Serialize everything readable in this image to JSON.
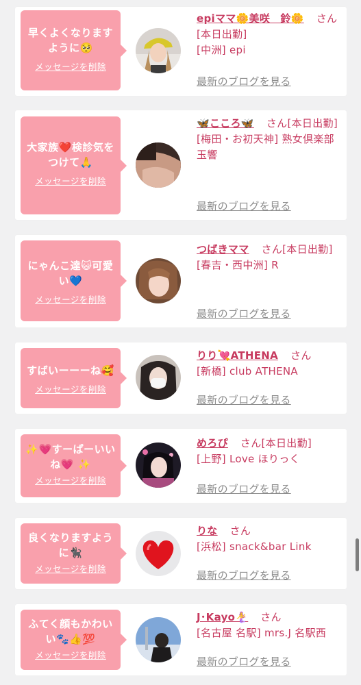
{
  "delete_label": "メッセージを削除",
  "blog_label": "最新のブログを見る",
  "san_label": "さん",
  "colors": {
    "bubble": "#f9a0ac",
    "name": "#c73a5f",
    "link_gray": "#8c8c8c",
    "card": "#ffffff",
    "page": "#f1f1f2"
  },
  "cards": [
    {
      "message": "早くよくなりますように🥺",
      "name": "epiママ🌼美咲　鈴🌼",
      "tail": "[本日出勤]",
      "shop": "[中洲] epi",
      "avatar": "photo-woman-yellow-cap"
    },
    {
      "message": "大家族❤️検診気をつけて🙏",
      "name": "🦋こころ🦋",
      "tail": "[本日出勤]",
      "shop": "[梅田・お初天神] 熟女倶楽部 玉響",
      "avatar": "photo-woman-shoulder"
    },
    {
      "message": "にゃんこ達😺可愛い💙",
      "name": "つばきママ",
      "tail": "[本日出勤]",
      "shop": "[春吉・西中洲] R",
      "avatar": "photo-woman-closeup"
    },
    {
      "message": "すばいーーーね🥰",
      "name": "りり💘ATHENA",
      "tail": "",
      "shop": "[新橋] club ATHENA",
      "avatar": "photo-woman-mask"
    },
    {
      "message": "✨💗すーぱーいいね💗 ✨",
      "name": "めろぴ",
      "tail": "[本日出勤]",
      "shop": "[上野] Love ほりっく",
      "avatar": "photo-woman-dark"
    },
    {
      "message": "良くなりますように🐈‍⬛",
      "name": "りな",
      "tail": "",
      "shop": "[浜松] snack&bar Link",
      "avatar": "red-heart-image"
    },
    {
      "message": "ふてく顔もかわいい🐾👍💯",
      "name": "J･Kayo🧜‍♀️",
      "tail": "",
      "shop": "[名古屋 名駅] mrs.J 名駅西",
      "avatar": "photo-person-sky"
    }
  ]
}
